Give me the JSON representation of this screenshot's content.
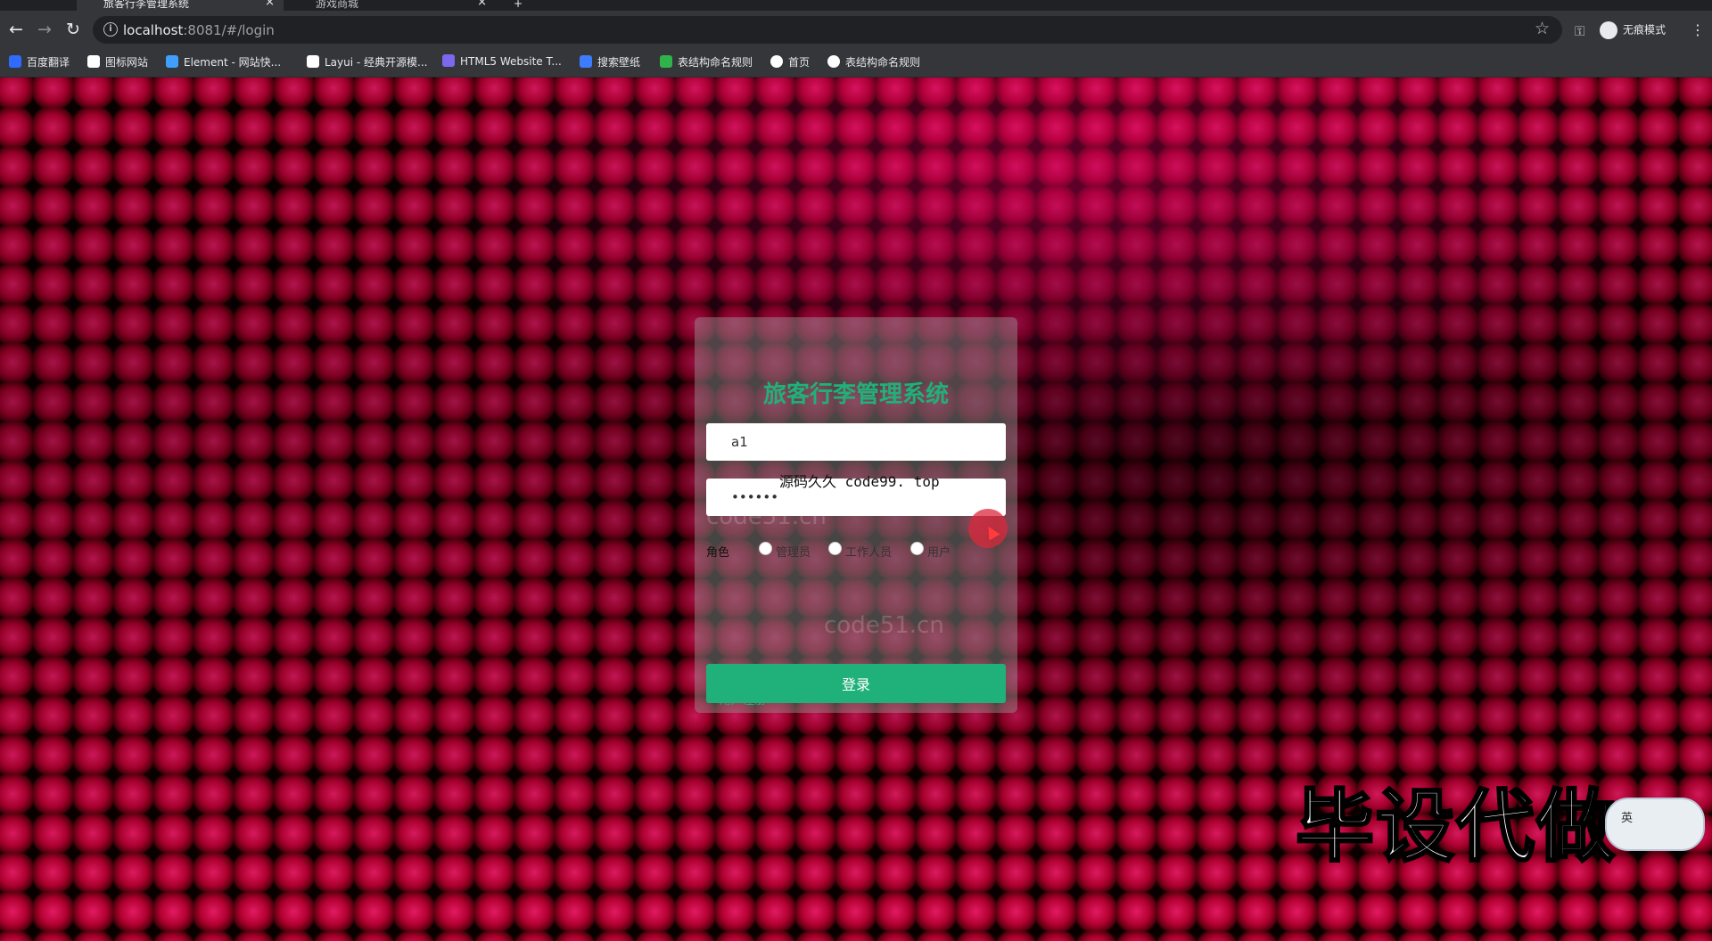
{
  "browser": {
    "tabs": [
      {
        "title": "旅客行李管理系统",
        "active": true
      },
      {
        "title": "游戏商城",
        "active": false
      }
    ],
    "new_tab": "+",
    "url_host": "localhost",
    "url_rest": ":8081/#/login",
    "incognito_label": "无痕模式",
    "bookmarks": [
      {
        "label": "百度翻译",
        "color": "#2f6bff"
      },
      {
        "label": "图标网站",
        "color": "#ffffff"
      },
      {
        "label": "Element - 网站快...",
        "color": "#409eff"
      },
      {
        "label": "Layui - 经典开源模...",
        "color": "#ffffff"
      },
      {
        "label": "HTML5 Website T...",
        "color": "#7b68ee"
      },
      {
        "label": "搜索壁纸",
        "color": "#3d7bff"
      },
      {
        "label": "表结构命名规则",
        "color": "#2fb34a"
      },
      {
        "label": "首页",
        "color": "#ffffff"
      },
      {
        "label": "表结构命名规则",
        "color": "#ffffff"
      }
    ]
  },
  "login": {
    "title": "旅客行李管理系统",
    "username_value": "a1",
    "password_value": "••••••",
    "role_label": "角色",
    "roles": [
      "管理员",
      "工作人员",
      "用户"
    ],
    "submit_label": "登录",
    "register_label": "用户注册"
  },
  "watermarks": {
    "center_text": "源码久久 code99. top",
    "site": "code51.cn"
  },
  "overlay": {
    "promo_text": "毕设代做",
    "ime_label": "英"
  },
  "colors": {
    "accent": "#20b07a",
    "background_dots": "#ff1e6e"
  }
}
